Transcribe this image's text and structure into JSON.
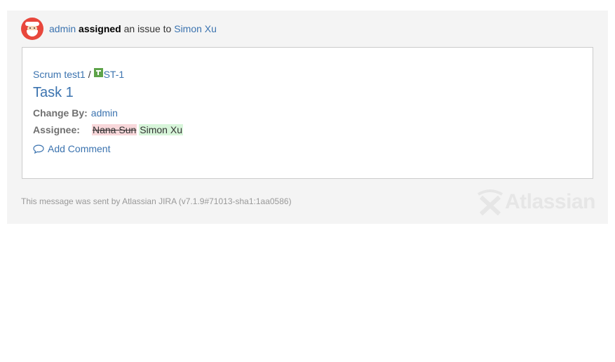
{
  "header": {
    "actor": "admin",
    "action": "assigned",
    "middle_text": "an issue to",
    "target_user": "Simon Xu"
  },
  "issue": {
    "project": "Scrum test1",
    "separator": "/",
    "key": "ST-1",
    "issue_type_icon": "task-icon",
    "title": "Task 1"
  },
  "fields": {
    "change_by_label": "Change By:",
    "change_by_value": "admin",
    "assignee_label": "Assignee:",
    "assignee_old": "Nana Sun",
    "assignee_new": "Simon Xu"
  },
  "actions": {
    "add_comment": "Add Comment"
  },
  "footer": {
    "message": "This message was sent by Atlassian JIRA (v7.1.9#71013-sha1:1aa0586)",
    "logo_text": "Atlassian"
  },
  "colors": {
    "link": "#3b73af",
    "removed_bg": "#f8d7da",
    "added_bg": "#d7f5d9",
    "panel_bg": "#f4f4f4"
  }
}
